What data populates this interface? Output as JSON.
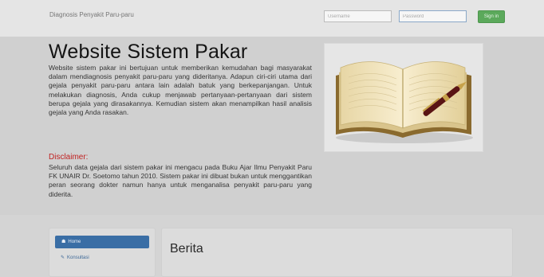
{
  "navbar": {
    "brand": "Diagnosis Penyakit Paru-paru",
    "username_placeholder": "Username",
    "password_placeholder": "Password",
    "signin_label": "Sign in"
  },
  "hero": {
    "title": "Website Sistem Pakar",
    "intro": "Website sistem pakar ini bertujuan untuk memberikan kemudahan bagi masyarakat dalam mendiagnosis penyakit paru-paru yang dideritanya. Adapun ciri-ciri utama dari gejala penyakit paru-paru antara lain adalah batuk yang berkepanjangan. Untuk melakukan diagnosis, Anda cukup menjawab pertanyaan-pertanyaan dari sistem berupa gejala yang dirasakannya. Kemudian sistem akan menampilkan hasil analisis gejala yang Anda rasakan.",
    "disclaimer_title": "Disclaimer:",
    "disclaimer_text": "Seluruh data gejala dari sistem pakar ini mengacu pada Buku Ajar Ilmu Penyakit Paru FK UNAIR Dr. Soetomo tahun 2010. Sistem pakar ini dibuat bukan untuk menggantikan peran seorang dokter namun hanya untuk menganalisa penyakit paru-paru yang diderita.",
    "image_icon": "open-book-with-pen"
  },
  "sidebar": {
    "items": [
      {
        "label": "Home",
        "icon": "home-icon",
        "active": true
      },
      {
        "label": "Konsultasi",
        "icon": "pencil-icon",
        "active": false
      }
    ]
  },
  "main": {
    "title": "Berita"
  },
  "colors": {
    "primary": "#3a6ea5",
    "signin": "#5ba95b",
    "disclaimer": "#c02222"
  }
}
